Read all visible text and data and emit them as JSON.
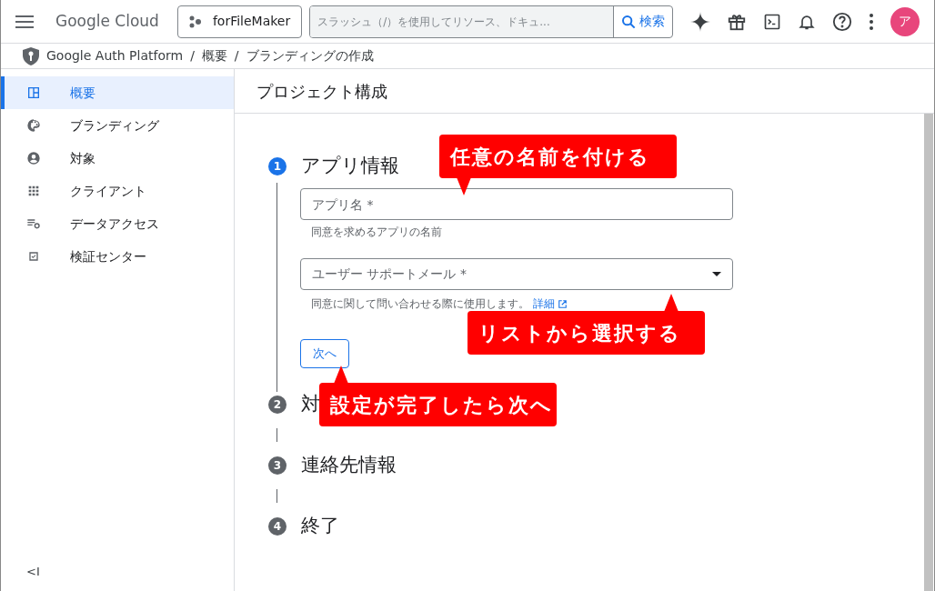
{
  "header": {
    "brand": "Google Cloud",
    "project": "forFileMaker",
    "search": {
      "placeholder": "スラッシュ（/）を使用してリソース、ドキュ..."
    },
    "search_button": "検索",
    "avatar": "ア"
  },
  "breadcrumb": {
    "items": [
      "Google Auth Platform",
      "概要",
      "ブランディングの作成"
    ],
    "separator": "/"
  },
  "sidebar": {
    "items": [
      {
        "label": "概要",
        "selected": true
      },
      {
        "label": "ブランディング",
        "selected": false
      },
      {
        "label": "対象",
        "selected": false
      },
      {
        "label": "クライアント",
        "selected": false
      },
      {
        "label": "データアクセス",
        "selected": false
      },
      {
        "label": "検証センター",
        "selected": false
      }
    ],
    "collapse": "<I"
  },
  "page_title": "プロジェクト構成",
  "steps": [
    {
      "number": "1",
      "title": "アプリ情報",
      "active": true
    },
    {
      "number": "2",
      "title": "対",
      "active": false
    },
    {
      "number": "3",
      "title": "連絡先情報",
      "active": false
    },
    {
      "number": "4",
      "title": "終了",
      "active": false
    }
  ],
  "form": {
    "app_name": {
      "placeholder": "アプリ名 *",
      "hint": "同意を求めるアプリの名前"
    },
    "support_email": {
      "placeholder": "ユーザー サポートメール *",
      "hint": "同意に関して問い合わせる際に使用します。",
      "link": "詳細"
    },
    "next_button": "次へ"
  },
  "callouts": [
    {
      "text": "任意の名前を付ける"
    },
    {
      "text": "リストから選択する"
    },
    {
      "text": "設定が完了したら次へ"
    }
  ]
}
